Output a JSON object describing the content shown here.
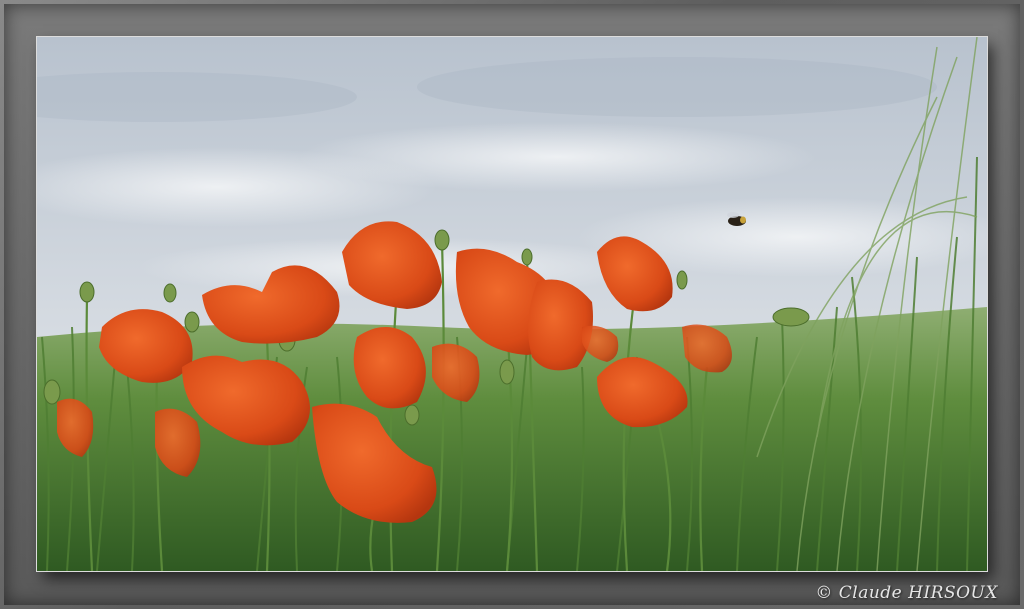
{
  "photo": {
    "credit": "© Claude HIRSOUX",
    "subject": "poppies",
    "colors": {
      "sky_top": "#b9c3cf",
      "sky_bottom": "#e6eaee",
      "grass": "#5c8a3a",
      "poppy": "#e0531e",
      "frame": "#6a6a6a"
    }
  }
}
